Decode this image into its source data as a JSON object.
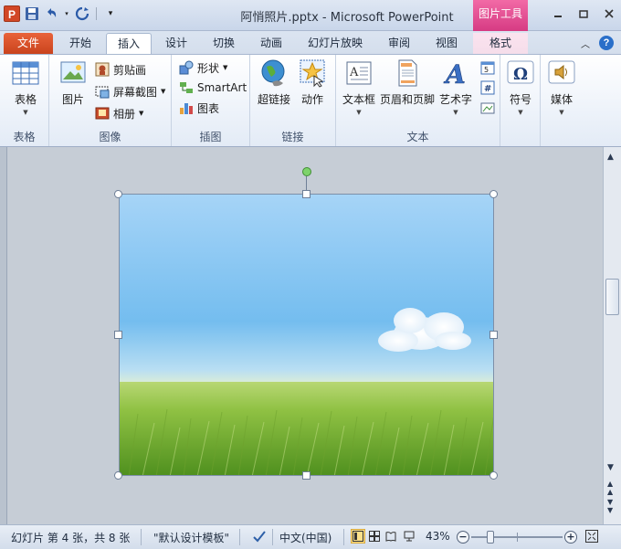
{
  "window": {
    "title": "阿悄照片.pptx  -  Microsoft PowerPoint",
    "context_tab_header": "图片工具",
    "app_logo": "P"
  },
  "tabs": [
    {
      "label": "文件"
    },
    {
      "label": "开始"
    },
    {
      "label": "插入"
    },
    {
      "label": "设计"
    },
    {
      "label": "切换"
    },
    {
      "label": "动画"
    },
    {
      "label": "幻灯片放映"
    },
    {
      "label": "审阅"
    },
    {
      "label": "视图"
    },
    {
      "label": "格式"
    }
  ],
  "active_tab": "插入",
  "help_label": "?",
  "ribbon": {
    "groups": {
      "tables": {
        "label": "表格",
        "table_button": "表格"
      },
      "images": {
        "label": "图像",
        "picture_button": "图片",
        "clipart_button": "剪贴画",
        "screenshot_button": "屏幕截图",
        "album_button": "相册"
      },
      "illustrations": {
        "label": "插图",
        "shapes_button": "形状",
        "smartart_button": "SmartArt",
        "chart_button": "图表"
      },
      "links": {
        "label": "链接",
        "hyperlink_button": "超链接",
        "action_button": "动作"
      },
      "text": {
        "label": "文本",
        "textbox_button": "文本框",
        "header_footer_button": "页眉和页脚",
        "wordart_button": "艺术字"
      },
      "symbols": {
        "symbol_button": "符号"
      },
      "media": {
        "media_button": "媒体"
      }
    }
  },
  "statusbar": {
    "slide_info": "幻灯片 第 4 张，共 8 张",
    "theme": "\"默认设计模板\"",
    "language": "中文(中国)",
    "zoom": "43%",
    "zoom_minus": "−",
    "zoom_plus": "+"
  },
  "colors": {
    "file_tab": "#d24726",
    "context_tab": "#e0508f",
    "ribbon_bg": "#eef3fa",
    "workspace_bg": "#c6cdd6",
    "sky_top": "#a8d4f5",
    "grass": "#8cbf3f"
  }
}
